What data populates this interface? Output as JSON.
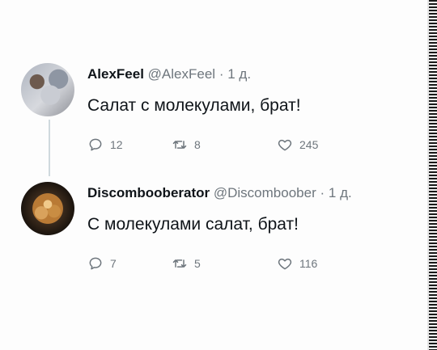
{
  "tweets": [
    {
      "author_name": "AlexFeel",
      "handle": "@AlexFeel",
      "separator": "·",
      "time": "1 д.",
      "text": "Салат с молекулами, брат!",
      "replies": "12",
      "retweets": "8",
      "likes": "245"
    },
    {
      "author_name": "Discombooberator",
      "handle": "@Discomboober",
      "separator": "·",
      "time": "1 д.",
      "text": "С молекулами салат, брат!",
      "replies": "7",
      "retweets": "5",
      "likes": "116"
    }
  ],
  "icons": {
    "reply": "reply-icon",
    "retweet": "retweet-icon",
    "like": "heart-icon"
  },
  "colors": {
    "text": "#0f1419",
    "muted": "#6e767d",
    "thread_line": "#cfd9de"
  }
}
